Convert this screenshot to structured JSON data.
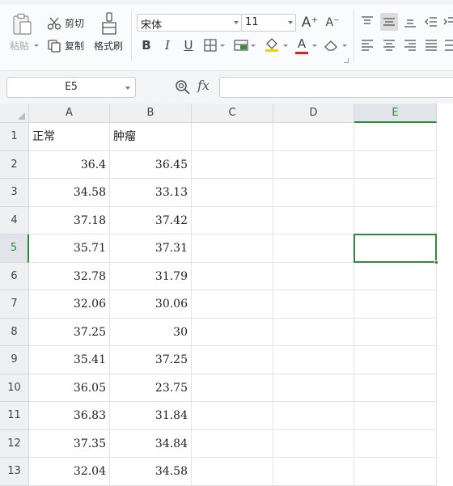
{
  "ribbon": {
    "paste_label": "粘贴",
    "cut_label": "剪切",
    "copy_label": "复制",
    "format_painter_label": "格式刷",
    "font_name": "宋体",
    "font_size": "11",
    "bold_label": "B",
    "italic_label": "I",
    "underline_label": "U",
    "font_color_label": "A",
    "increase_font_label": "A⁺",
    "decrease_font_label": "A⁻",
    "colors": {
      "font_color_bar": "#e02020",
      "fill_color_bar": "#f5d000"
    }
  },
  "formula_bar": {
    "name_box": "E5",
    "fx_label": "fx",
    "formula": ""
  },
  "grid": {
    "columns": [
      "A",
      "B",
      "C",
      "D",
      "E"
    ],
    "active_column": "E",
    "active_row": "5",
    "rows": [
      {
        "n": "1",
        "a": "正常",
        "b": "肿瘤"
      },
      {
        "n": "2",
        "a": "36.4",
        "b": "36.45"
      },
      {
        "n": "3",
        "a": "34.58",
        "b": "33.13"
      },
      {
        "n": "4",
        "a": "37.18",
        "b": "37.42"
      },
      {
        "n": "5",
        "a": "35.71",
        "b": "37.31"
      },
      {
        "n": "6",
        "a": "32.78",
        "b": "31.79"
      },
      {
        "n": "7",
        "a": "32.06",
        "b": "30.06"
      },
      {
        "n": "8",
        "a": "37.25",
        "b": "30"
      },
      {
        "n": "9",
        "a": "35.41",
        "b": "37.25"
      },
      {
        "n": "10",
        "a": "36.05",
        "b": "23.75"
      },
      {
        "n": "11",
        "a": "36.83",
        "b": "31.84"
      },
      {
        "n": "12",
        "a": "37.35",
        "b": "34.84"
      },
      {
        "n": "13",
        "a": "32.04",
        "b": "34.58"
      }
    ],
    "accent_color": "#2f8b3a"
  }
}
